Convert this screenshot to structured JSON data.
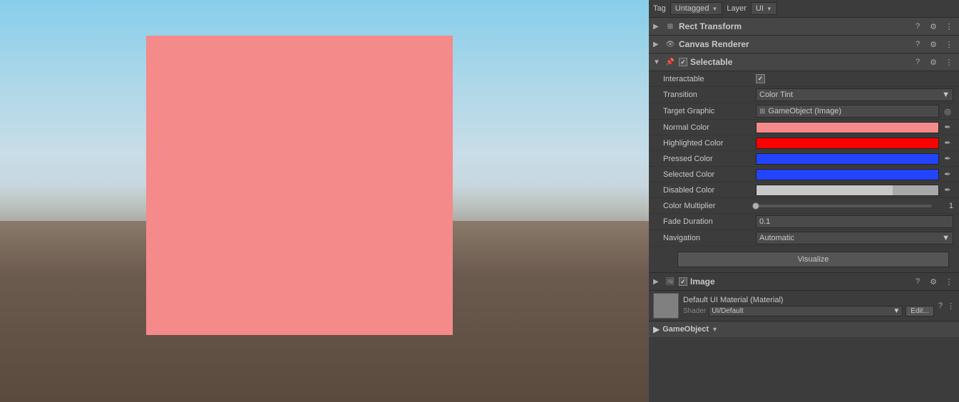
{
  "viewport": {
    "pink_square_color": "#f48a8a"
  },
  "tag_layer": {
    "tag_label": "Tag",
    "tag_value": "Untagged",
    "layer_label": "Layer",
    "layer_value": "UI"
  },
  "components": {
    "rect_transform": {
      "title": "Rect Transform",
      "collapsed": true
    },
    "canvas_renderer": {
      "title": "Canvas Renderer",
      "collapsed": true
    },
    "selectable": {
      "title": "Selectable",
      "enabled": true
    },
    "image": {
      "title": "Image",
      "enabled": true
    }
  },
  "selectable": {
    "interactable_label": "Interactable",
    "interactable_checked": true,
    "transition_label": "Transition",
    "transition_value": "Color Tint",
    "target_graphic_label": "Target Graphic",
    "target_graphic_value": "GameObject (Image)",
    "normal_color_label": "Normal Color",
    "normal_color": "#f48a8a",
    "highlighted_color_label": "Highlighted Color",
    "highlighted_color": "#ff0000",
    "pressed_color_label": "Pressed Color",
    "pressed_color": "#2244ff",
    "selected_color_label": "Selected Color",
    "selected_color": "#2244ff",
    "disabled_color_label": "Disabled Color",
    "disabled_color": "#c8c8c8",
    "color_multiplier_label": "Color Multiplier",
    "color_multiplier_value": "1",
    "color_multiplier_pct": 0,
    "fade_duration_label": "Fade Duration",
    "fade_duration_value": "0.1",
    "navigation_label": "Navigation",
    "navigation_value": "Automatic",
    "visualize_label": "Visualize"
  },
  "image_component": {
    "material_name": "Default UI Material (Material)",
    "shader_label": "Shader",
    "shader_value": "UI/Default",
    "edit_label": "Edit..."
  },
  "gameobject_row": {
    "label": "GameObject"
  },
  "icons": {
    "check": "✓",
    "arrow_right": "▶",
    "arrow_down": "▼",
    "question": "?",
    "settings": "⚙",
    "more": "⋮",
    "circle_target": "◎",
    "eyedropper": "✒"
  }
}
